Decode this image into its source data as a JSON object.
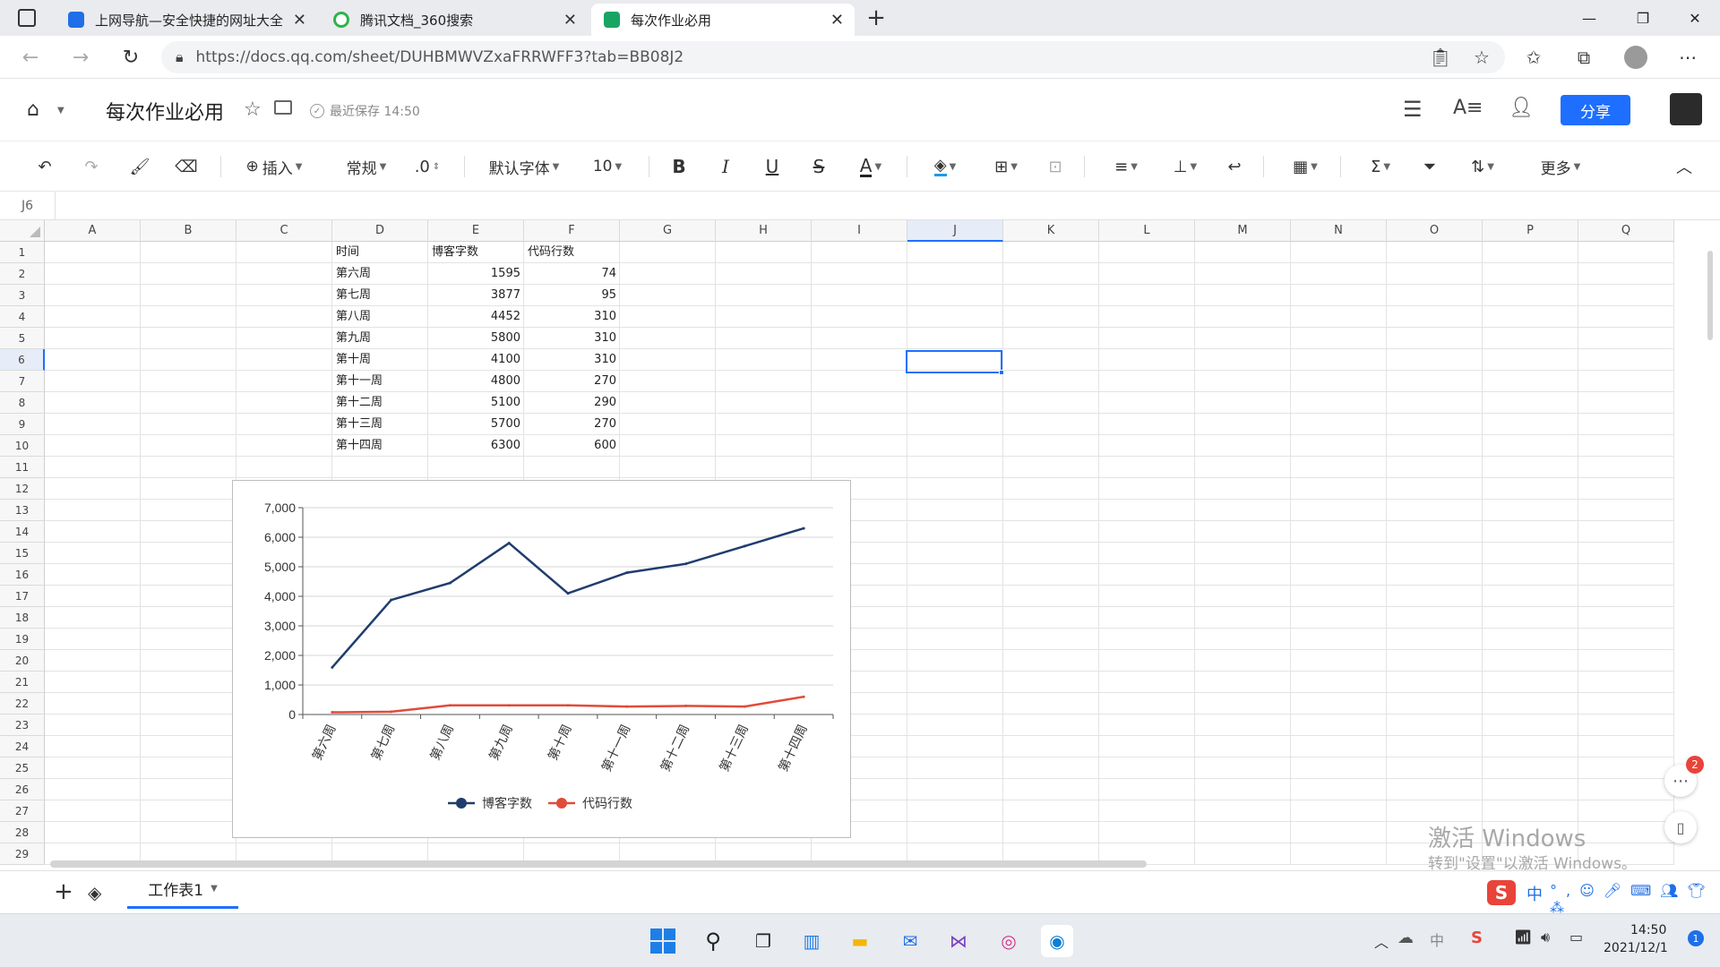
{
  "browser": {
    "tabs": [
      {
        "title": "上网导航—安全快捷的网址大全",
        "icon": "hao-nav-icon",
        "color": "#1e6fe8"
      },
      {
        "title": "腾讯文档_360搜索",
        "icon": "search360-icon",
        "color": "#2fb34a"
      },
      {
        "title": "每次作业必用",
        "icon": "sheet-icon",
        "color": "#19a463"
      }
    ],
    "url": "https://docs.qq.com/sheet/DUHBMWVZxaFRRWFF3?tab=BB08J2"
  },
  "doc": {
    "title": "每次作业必用",
    "save_status": "最近保存 14:50",
    "share_label": "分享"
  },
  "toolbar": {
    "insert": "插入",
    "format": "常规",
    "decimal": ".0",
    "font": "默认字体",
    "font_size": "10",
    "more": "更多"
  },
  "formula_bar": {
    "cell_ref": "J6",
    "value": ""
  },
  "grid": {
    "columns": [
      "A",
      "B",
      "C",
      "D",
      "E",
      "F",
      "G",
      "H",
      "I",
      "J",
      "K",
      "L",
      "M",
      "N",
      "O",
      "P",
      "Q"
    ],
    "rows": [
      "1",
      "2",
      "3",
      "4",
      "5",
      "6",
      "7",
      "8",
      "9",
      "10",
      "11",
      "12",
      "13",
      "14",
      "15",
      "16",
      "17",
      "18",
      "19",
      "20",
      "21",
      "22",
      "23",
      "24",
      "25",
      "26",
      "27",
      "28",
      "29"
    ],
    "table_header": [
      "时间",
      "博客字数",
      "代码行数"
    ],
    "table_rows": [
      [
        "第六周",
        "1595",
        "74"
      ],
      [
        "第七周",
        "3877",
        "95"
      ],
      [
        "第八周",
        "4452",
        "310"
      ],
      [
        "第九周",
        "5800",
        "310"
      ],
      [
        "第十周",
        "4100",
        "310"
      ],
      [
        "第十一周",
        "4800",
        "270"
      ],
      [
        "第十二周",
        "5100",
        "290"
      ],
      [
        "第十三周",
        "5700",
        "270"
      ],
      [
        "第十四周",
        "6300",
        "600"
      ]
    ],
    "selected_cell": "J6"
  },
  "chart_data": {
    "type": "line",
    "categories": [
      "第六周",
      "第七周",
      "第八周",
      "第九周",
      "第十周",
      "第十一周",
      "第十二周",
      "第十三周",
      "第十四周"
    ],
    "series": [
      {
        "name": "博客字数",
        "values": [
          1595,
          3877,
          4452,
          5800,
          4100,
          4800,
          5100,
          5700,
          6300
        ],
        "color": "#1f3d6e"
      },
      {
        "name": "代码行数",
        "values": [
          74,
          95,
          310,
          310,
          310,
          270,
          290,
          270,
          600
        ],
        "color": "#e04b3a"
      }
    ],
    "ylim": [
      0,
      7000
    ],
    "yticks": [
      "0",
      "1,000",
      "2,000",
      "3,000",
      "4,000",
      "5,000",
      "6,000",
      "7,000"
    ],
    "grid": true,
    "legend": "bottom"
  },
  "sheets": {
    "active": "工作表1"
  },
  "notifications": {
    "count": "2"
  },
  "watermark": {
    "line1": "激活 Windows",
    "line2": "转到\"设置\"以激活 Windows。"
  },
  "taskbar": {
    "time": "14:50",
    "date": "2021/12/1"
  },
  "ime": {
    "lang": "中"
  }
}
